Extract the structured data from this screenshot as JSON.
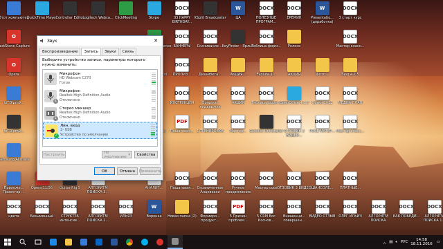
{
  "desktop": {
    "icons": [
      {
        "label": "Этот компьютер",
        "type": "app",
        "col": 0,
        "row": 0
      },
      {
        "label": "QuickTime Player",
        "type": "sky",
        "col": 1,
        "row": 0
      },
      {
        "label": "Controller Editor",
        "type": "dark",
        "col": 2,
        "row": 0
      },
      {
        "label": "Logitech Webca...",
        "type": "dark",
        "col": 3,
        "row": 0
      },
      {
        "label": "ClickMeeting",
        "type": "green",
        "col": 4,
        "row": 0
      },
      {
        "label": "Skype",
        "type": "sky",
        "col": 5,
        "row": 0
      },
      {
        "label": "03 HAPPY BIRTHDAY...",
        "type": "doc",
        "col": 6,
        "row": 0
      },
      {
        "label": "XSplit Broadcaster",
        "type": "dark",
        "col": 7,
        "row": 0
      },
      {
        "label": "ЦА",
        "type": "docx",
        "col": 8,
        "row": 0
      },
      {
        "label": "ПОЛЕЗНЫЕ ПРОГРАМ...",
        "type": "doc",
        "col": 9,
        "row": 0
      },
      {
        "label": "ЕРЕМИН",
        "type": "doc",
        "col": 10,
        "row": 0
      },
      {
        "label": "Presentatio... (доработка)",
        "type": "docx",
        "col": 11,
        "row": 0
      },
      {
        "label": "3 старт курс",
        "type": "doc",
        "col": 12,
        "row": 0
      },
      {
        "label": "",
        "type": "red",
        "col": 0,
        "row": 1
      },
      {
        "label": "FastStone Capture",
        "type": "red",
        "col": 0,
        "row": 1
      },
      {
        "label": "GeForce Experience",
        "type": "green",
        "col": 5,
        "row": 1
      },
      {
        "label": "БАННЕРЫ",
        "type": "doc",
        "col": 6,
        "row": 1
      },
      {
        "label": "Скачивание ...",
        "type": "doc",
        "col": 7,
        "row": 1
      },
      {
        "label": "KeyFinder - Ярлык",
        "type": "dark",
        "col": 8,
        "row": 1
      },
      {
        "label": "Таблица форм...",
        "type": "doc",
        "col": 9,
        "row": 1
      },
      {
        "label": "Релосе",
        "type": "folder",
        "col": 10,
        "row": 1
      },
      {
        "label": "Мастер класс...",
        "type": "doc",
        "col": 12,
        "row": 1
      },
      {
        "label": "Opera",
        "type": "red",
        "col": 0,
        "row": 2
      },
      {
        "label": "Creative Cloud",
        "type": "red",
        "col": 5,
        "row": 2
      },
      {
        "label": "ПРОПИЗ...",
        "type": "doc",
        "col": 6,
        "row": 2
      },
      {
        "label": "Дизайбета...",
        "type": "folder",
        "col": 7,
        "row": 2
      },
      {
        "label": "АКЦИЯ...",
        "type": "folder",
        "col": 8,
        "row": 2
      },
      {
        "label": "Evolute 1...",
        "type": "folder",
        "col": 9,
        "row": 2
      },
      {
        "label": "АКЦИЯ",
        "type": "folder",
        "col": 10,
        "row": 2
      },
      {
        "label": "Фото...",
        "type": "folder",
        "col": 11,
        "row": 2
      },
      {
        "label": "Бюд 4.7.5",
        "type": "folder",
        "col": 12,
        "row": 2
      },
      {
        "label": "fpTDIpm9...",
        "type": "app",
        "col": 0,
        "row": 3
      },
      {
        "label": "ИНСТРУКЦИЯ",
        "type": "doc",
        "col": 6,
        "row": 3
      },
      {
        "label": "Вопросы поддержке",
        "type": "doc",
        "col": 7,
        "row": 3
      },
      {
        "label": "АКЦИЯ",
        "type": "doc",
        "col": 8,
        "row": 3
      },
      {
        "label": "Таблица форм...",
        "type": "doc",
        "col": 9,
        "row": 3
      },
      {
        "label": "OpenOffice 4.1.3",
        "type": "sky",
        "col": 10,
        "row": 3
      },
      {
        "label": "Сутки 2011",
        "type": "doc",
        "col": 11,
        "row": 3
      },
      {
        "label": "МЕДИА ПЛАН",
        "type": "doc",
        "col": 12,
        "row": 3
      },
      {
        "label": "fpTDIpm9...",
        "type": "dark",
        "col": 0,
        "row": 4
      },
      {
        "label": "VkBot Ярлык",
        "type": "doc",
        "col": 5,
        "row": 4
      },
      {
        "label": "Пошаговая...",
        "type": "pdf",
        "col": 6,
        "row": 4
      },
      {
        "label": "1 ТРЕНИРОВКА",
        "type": "doc",
        "col": 7,
        "row": 4
      },
      {
        "label": "Мастер...",
        "type": "doc",
        "col": 8,
        "row": 4
      },
      {
        "label": "Geeklist Uninstaller",
        "type": "dark",
        "col": 9,
        "row": 4
      },
      {
        "label": "ОТЗОВИК 3 ВИДЕО...",
        "type": "doc",
        "col": 10,
        "row": 4
      },
      {
        "label": "РОСЕ МАТЕР...",
        "type": "doc",
        "col": 11,
        "row": 4
      },
      {
        "label": "Мастер класс...",
        "type": "doc",
        "col": 12,
        "row": 4
      },
      {
        "label": "Samsung Allshare",
        "type": "app",
        "col": 0,
        "row": 5
      },
      {
        "label": "Приложе... Проектор ...",
        "type": "app",
        "col": 0,
        "row": 6
      },
      {
        "label": "Opera 11.56",
        "type": "red",
        "col": 1,
        "row": 6
      },
      {
        "label": "Guitar Rig 5",
        "type": "dark",
        "col": 2,
        "row": 6
      },
      {
        "label": "АЛГОРИТМ ПОИСКА З...",
        "type": "doc",
        "col": 3,
        "row": 6
      },
      {
        "label": "АНАЛИТ...",
        "type": "pdf",
        "col": 5,
        "row": 6
      },
      {
        "label": "Пошаговая...",
        "type": "doc",
        "col": 6,
        "row": 6
      },
      {
        "label": "Ограниченное Анцевеаси",
        "type": "doc",
        "col": 7,
        "row": 6
      },
      {
        "label": "Ручное продвижение",
        "type": "doc",
        "col": 8,
        "row": 6
      },
      {
        "label": "Мастер сосе",
        "type": "doc",
        "col": 9,
        "row": 6
      },
      {
        "label": "ОТЗОВИК 3 ВИДЕО",
        "type": "doc",
        "col": 10,
        "row": 6
      },
      {
        "label": "ШАНСОЛЕ...",
        "type": "doc",
        "col": 11,
        "row": 6
      },
      {
        "label": "ПЛАТНЫЕ...",
        "type": "doc",
        "col": 12,
        "row": 6
      },
      {
        "label": "цвета",
        "type": "doc",
        "col": 0,
        "row": 7
      },
      {
        "label": "Безымянный",
        "type": "doc",
        "col": 1,
        "row": 7
      },
      {
        "label": "СТРУКТРА интенсив...",
        "type": "doc",
        "col": 2,
        "row": 7
      },
      {
        "label": "АЛГОРИТМ ПОИСКА 2...",
        "type": "doc",
        "col": 3,
        "row": 7
      },
      {
        "label": "ИЛЬЯЗ",
        "type": "doc",
        "col": 4,
        "row": 7
      },
      {
        "label": "Воронка",
        "type": "docx",
        "col": 5,
        "row": 7
      },
      {
        "label": "Новая папка (2)",
        "type": "folder",
        "col": 6,
        "row": 7
      },
      {
        "label": "Формиро... продукт...",
        "type": "doc",
        "col": 7,
        "row": 7
      },
      {
        "label": "5 Причин проблем...",
        "type": "pdf",
        "col": 8,
        "row": 7
      },
      {
        "label": "5 CRM Вос Коснов...",
        "type": "doc",
        "col": 9,
        "row": 7
      },
      {
        "label": "Внешенни... повершен...",
        "type": "doc",
        "col": 10,
        "row": 7
      },
      {
        "label": "ВИДЕО ОТЗЫВ",
        "type": "doc",
        "col": 11,
        "row": 7
      },
      {
        "label": "ОЛЕГ ИЛЬИЧ",
        "type": "doc",
        "col": 12,
        "row": 7
      },
      {
        "label": "АЛГОРИТМ ПОИСКА",
        "type": "doc",
        "col": 13,
        "row": 7
      },
      {
        "label": "КАК ПОБЕДИ...",
        "type": "doc",
        "col": 14,
        "row": 7
      },
      {
        "label": "АЛГОРИТМ ПОИСКА 1...",
        "type": "doc",
        "col": 15,
        "row": 7
      }
    ]
  },
  "dialog": {
    "title": "Звук",
    "tabs": [
      "Воспроизведение",
      "Запись",
      "Звуки",
      "Связь"
    ],
    "active_tab": 1,
    "intro": "Выберите устройство записи, параметры которого нужно изменить:",
    "devices": [
      {
        "name": "Микрофон",
        "sub1": "HD Webcam C270",
        "sub2": "Готов",
        "icon": "microphone-icon",
        "status": "",
        "level": 2
      },
      {
        "name": "Микрофон",
        "sub1": "Realtek High Definition Audio",
        "sub2": "Отключено",
        "icon": "microphone-icon",
        "status": "disabled",
        "level": 0
      },
      {
        "name": "Стерео микшер",
        "sub1": "Realtek High Definition Audio",
        "sub2": "Отключено",
        "icon": "stereo-mixer-icon",
        "status": "disabled",
        "level": 0
      },
      {
        "name": "Лин. вход",
        "sub1": "2- USB",
        "sub2": "Устройство по умолчанию",
        "icon": "line-in-icon",
        "status": "default",
        "level": 3
      }
    ],
    "configure_label": "Настроить",
    "default_label": "По умолчанию",
    "properties_label": "Свойства",
    "ok_label": "ОК",
    "cancel_label": "Отмена",
    "apply_label": "Применить",
    "colors": {
      "selection": "#cde8ff",
      "meter_on": "#22b14c",
      "status_default": "#22b14c",
      "status_disabled": "#888888"
    }
  },
  "taskbar": {
    "language": "РУС",
    "time": "14:58",
    "date": "18.11.2016"
  }
}
